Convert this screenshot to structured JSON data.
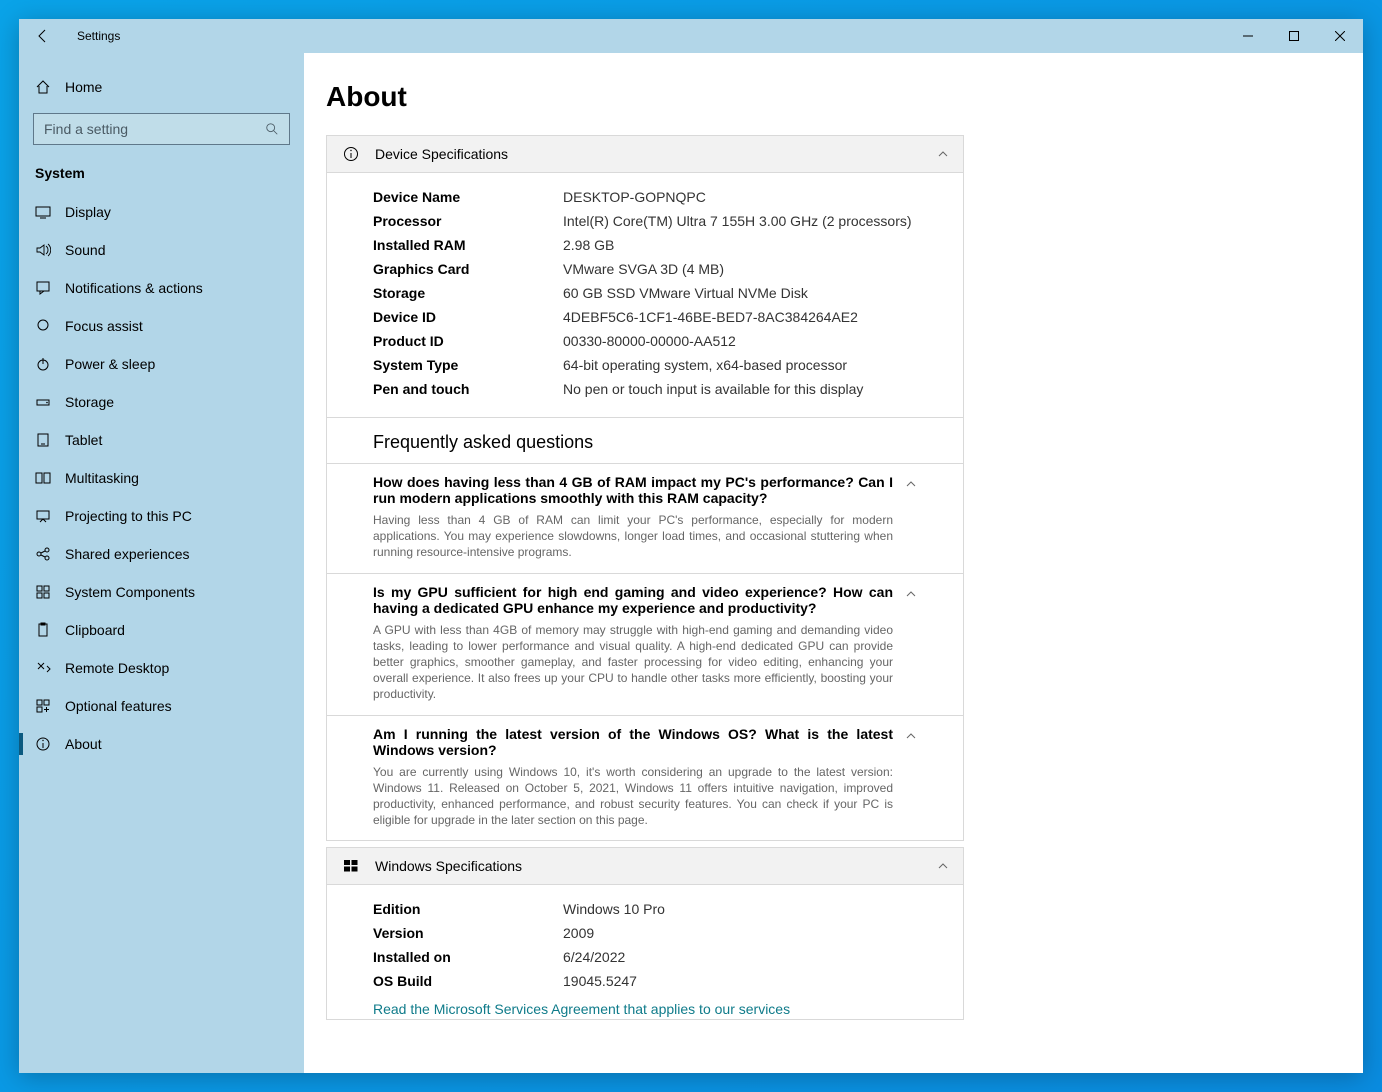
{
  "window": {
    "title": "Settings"
  },
  "sidebar": {
    "home": "Home",
    "search_placeholder": "Find a setting",
    "section": "System",
    "items": [
      {
        "label": "Display"
      },
      {
        "label": "Sound"
      },
      {
        "label": "Notifications & actions"
      },
      {
        "label": "Focus assist"
      },
      {
        "label": "Power & sleep"
      },
      {
        "label": "Storage"
      },
      {
        "label": "Tablet"
      },
      {
        "label": "Multitasking"
      },
      {
        "label": "Projecting to this PC"
      },
      {
        "label": "Shared experiences"
      },
      {
        "label": "System Components"
      },
      {
        "label": "Clipboard"
      },
      {
        "label": "Remote Desktop"
      },
      {
        "label": "Optional features"
      },
      {
        "label": "About"
      }
    ]
  },
  "page": {
    "heading": "About",
    "device_panel": {
      "title": "Device Specifications",
      "rows": [
        {
          "label": "Device Name",
          "value": "DESKTOP-GOPNQPC"
        },
        {
          "label": "Processor",
          "value": "Intel(R) Core(TM) Ultra 7 155H   3.00 GHz  (2 processors)"
        },
        {
          "label": "Installed RAM",
          "value": "2.98 GB"
        },
        {
          "label": "Graphics Card",
          "value": "VMware SVGA 3D (4 MB)"
        },
        {
          "label": "Storage",
          "value": "60 GB SSD VMware Virtual NVMe Disk"
        },
        {
          "label": "Device ID",
          "value": "4DEBF5C6-1CF1-46BE-BED7-8AC384264AE2"
        },
        {
          "label": "Product ID",
          "value": "00330-80000-00000-AA512"
        },
        {
          "label": "System Type",
          "value": "64-bit operating system, x64-based processor"
        },
        {
          "label": "Pen and touch",
          "value": "No pen or touch input is available for this display"
        }
      ]
    },
    "faq": {
      "title": "Frequently asked questions",
      "items": [
        {
          "q": "How does having less than 4 GB of RAM impact my PC's performance? Can I run modern applications smoothly with this RAM capacity?",
          "a": "Having less than 4 GB of RAM can limit your PC's performance, especially for modern applications. You may experience slowdowns, longer load times, and occasional stuttering when running resource-intensive programs."
        },
        {
          "q": "Is my GPU sufficient for high end gaming and video experience? How can having a dedicated GPU enhance my experience and productivity?",
          "a": "A GPU with less than 4GB of memory may struggle with high-end gaming and demanding video tasks, leading to lower performance and visual quality. A high-end dedicated GPU can provide better graphics, smoother gameplay, and faster processing for video editing, enhancing your overall experience. It also frees up your CPU to handle other tasks more efficiently, boosting your productivity."
        },
        {
          "q": "Am I running the latest version of the Windows OS? What is the latest Windows version?",
          "a": "You are currently using Windows 10, it's worth considering an upgrade to the latest version: Windows 11. Released on October 5, 2021, Windows 11 offers intuitive navigation, improved productivity, enhanced performance, and robust security features. You can check if your PC is eligible for upgrade in the later section on this page."
        }
      ]
    },
    "windows_panel": {
      "title": "Windows Specifications",
      "rows": [
        {
          "label": "Edition",
          "value": "Windows 10 Pro"
        },
        {
          "label": "Version",
          "value": "2009"
        },
        {
          "label": "Installed on",
          "value": "6/24/2022"
        },
        {
          "label": "OS Build",
          "value": "19045.5247"
        }
      ],
      "link": "Read the Microsoft Services Agreement that applies to our services"
    }
  }
}
